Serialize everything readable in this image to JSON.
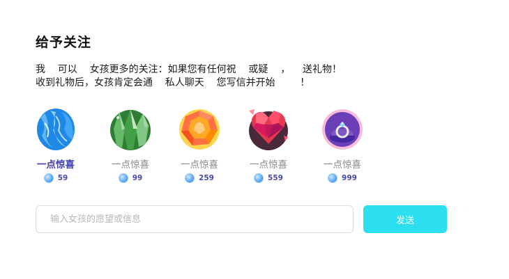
{
  "panel": {
    "title": "给予关注",
    "description_line1": "我    可以    女孩更多的关注：如果您有任何祝    或疑    ，    送礼物！",
    "description_line2": "收到礼物后，女孩肯定会通    私人聊天    您写信并开始        ！"
  },
  "gifts": [
    {
      "name": "一点惊喜",
      "price": "59",
      "icon": "blue-crystal-icon",
      "selected": true
    },
    {
      "name": "一点惊喜",
      "price": "99",
      "icon": "green-crystal-icon",
      "selected": false
    },
    {
      "name": "一点惊喜",
      "price": "259",
      "icon": "orange-gem-icon",
      "selected": false
    },
    {
      "name": "一点惊喜",
      "price": "559",
      "icon": "ruby-heart-icon",
      "selected": false
    },
    {
      "name": "一点惊喜",
      "price": "999",
      "icon": "ring-box-icon",
      "selected": false
    }
  ],
  "currency_icon": "diamond-icon",
  "message": {
    "placeholder": "输入女孩的愿望或信息",
    "value": ""
  },
  "send_button": {
    "label": "发送"
  },
  "colors": {
    "accent": "#2ddfee",
    "selected_text": "#3f3fb0",
    "price_text": "#4a4aa8"
  }
}
